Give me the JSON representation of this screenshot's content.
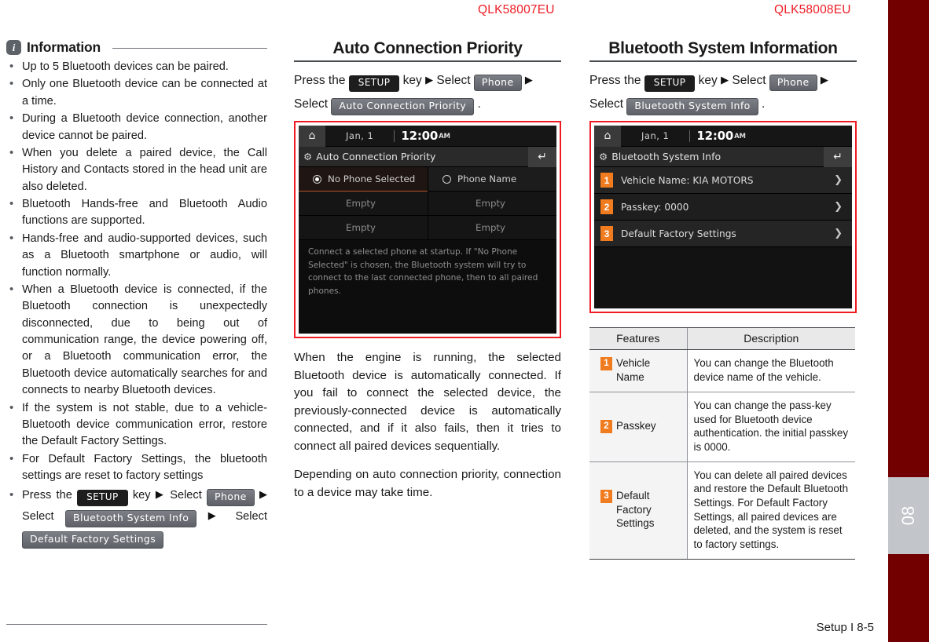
{
  "figure_codes": {
    "middle": "QLK58007EU",
    "right": "QLK58008EU"
  },
  "spine": {
    "chapter_number": "08"
  },
  "footer": {
    "text": "Setup I 8-5"
  },
  "information": {
    "icon": "info-icon",
    "title": "Information",
    "bullets": [
      "Up to 5 Bluetooth devices can be paired.",
      "Only one Bluetooth device can be connected at a time.",
      "During a Bluetooth device connection, another device cannot be paired.",
      "When you delete a paired device, the Call History and Contacts stored in the head unit are also deleted.",
      "Bluetooth Hands-free and Bluetooth Audio functions are supported.",
      "Hands-free and audio-supported devices, such as a Bluetooth smartphone or audio, will function normally.",
      "When a Bluetooth device is connected, if the Bluetooth connection is unexpectedly disconnected, due to being out of communication range, the device powering off, or a Bluetooth communication error, the Bluetooth device automatically searches for and connects to nearby Bluetooth devices.",
      "If the system is not stable, due to a vehicle-Bluetooth device communication error, restore the Default Factory Settings.",
      "For Default Factory Settings, the bluetooth settings are reset to factory settings"
    ],
    "last_step": {
      "press_the": "Press the",
      "setup_key": "SETUP",
      "key": "key",
      "arrow": "▶",
      "select": "Select",
      "phone_chip": "Phone",
      "bsi_chip": "Bluetooth System Info",
      "dfs_chip": "Default Factory Settings"
    }
  },
  "middle": {
    "title": "Auto Connection Priority",
    "steps": {
      "press_the": "Press the",
      "setup_key": "SETUP",
      "key": "key",
      "arrow": "▶",
      "select": "Select",
      "phone_chip": "Phone",
      "select2": "Select",
      "acp_chip": "Auto Connection Priority",
      "period": "."
    },
    "screenshot": {
      "home_icon": "home-icon",
      "date": "Jan,  1",
      "time": "12:00",
      "ampm": "AM",
      "gear_icon": "gear-icon",
      "title": "Auto Connection Priority",
      "back_icon": "back-arrow-icon",
      "rows": [
        {
          "left": "No Phone Selected",
          "left_state": "selected",
          "right": "Phone Name",
          "right_state": "unselected"
        },
        {
          "left": "Empty",
          "right": "Empty"
        },
        {
          "left": "Empty",
          "right": "Empty"
        }
      ],
      "note": "Connect a selected phone at startup. If \"No Phone Selected\" is chosen, the Bluetooth system will try to connect to the last connected phone, then to all paired phones."
    },
    "paragraphs": [
      "When the engine is running, the selected Bluetooth device is automatically connected. If you fail to connect the selected device, the previously-connected device is automatically connected, and if it also fails, then it tries to connect all paired devices sequentially.",
      "Depending on auto connection priority, connection to a device may take time."
    ]
  },
  "right": {
    "title": "Bluetooth System Information",
    "steps": {
      "press_the": "Press the",
      "setup_key": "SETUP",
      "key": "key",
      "arrow": "▶",
      "select": "Select",
      "phone_chip": "Phone",
      "select2": "Select",
      "bsi_chip": "Bluetooth System Info",
      "period": "."
    },
    "screenshot": {
      "home_icon": "home-icon",
      "date": "Jan,  1",
      "time": "12:00",
      "ampm": "AM",
      "gear_icon": "gear-icon",
      "title": "Bluetooth System Info",
      "back_icon": "back-arrow-icon",
      "rows": [
        {
          "num": "1",
          "label": "Vehicle Name: KIA MOTORS"
        },
        {
          "num": "2",
          "label": "Passkey: 0000"
        },
        {
          "num": "3",
          "label": "Default Factory Settings"
        }
      ]
    },
    "table": {
      "headers": [
        "Features",
        "Description"
      ],
      "rows": [
        {
          "num": "1",
          "feature": "Vehicle Name",
          "description": "You can change the Bluetooth device name of the vehicle."
        },
        {
          "num": "2",
          "feature": "Passkey",
          "description": "You can change the pass-key used for Bluetooth device authentication. the initial passkey is 0000."
        },
        {
          "num": "3",
          "feature": "Default Factory Settings",
          "description": "You can delete all paired devices and restore the Default Bluetooth Settings. For Default Factory Settings, all paired devices are deleted, and the system is reset to factory settings."
        }
      ]
    }
  },
  "colors": {
    "accent_red": "#ee1b24",
    "spine_maroon": "#730000",
    "orange_badge": "#f07c1f",
    "tab_gray": "#c2c5c9"
  }
}
